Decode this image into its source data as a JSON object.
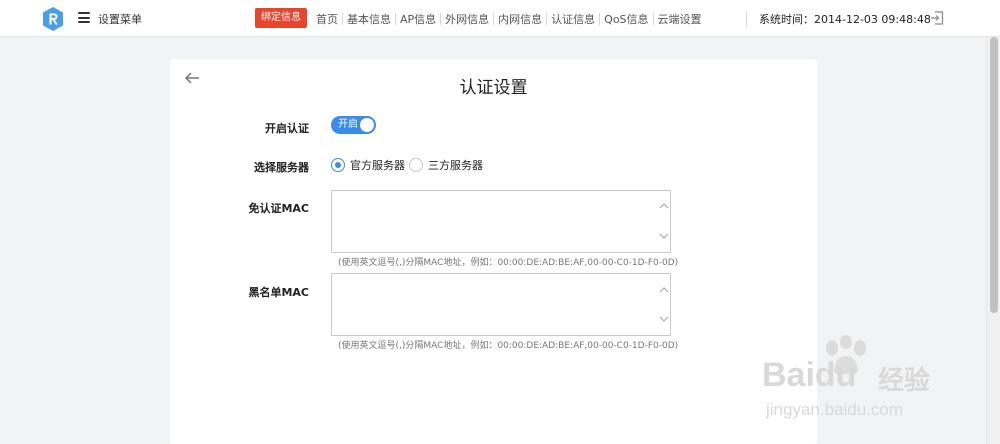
{
  "header": {
    "menu_label": "设置菜单",
    "bind_button": "绑定信息",
    "nav": [
      "首页",
      "基本信息",
      "AP信息",
      "外网信息",
      "内网信息",
      "认证信息",
      "QoS信息",
      "云端设置"
    ],
    "system_time": "系统时间：2014-12-03 09:48:48"
  },
  "page": {
    "title": "认证设置"
  },
  "form": {
    "auth_label": "开启认证",
    "toggle_text": "开启",
    "toggle_on": true,
    "server_label": "选择服务器",
    "server_options": [
      "官方服务器",
      "三方服务器"
    ],
    "server_selected": "官方服务器",
    "free_mac_label": "免认证MAC",
    "free_mac_value": "",
    "free_mac_hint": "(使用英文逗号(,)分隔MAC地址，例如：00:00:DE:AD:BE:AF,00-00-C0-1D-F0-0D)",
    "blacklist_label": "黑名单MAC",
    "blacklist_value": "",
    "blacklist_hint": "(使用英文逗号(,)分隔MAC地址，例如：00:00:DE:AD:BE:AF,00-00-C0-1D-F0-0D)"
  },
  "watermark": {
    "brand": "Baidu",
    "brand_cn": "经验",
    "url": "jingyan.baidu.com"
  },
  "colors": {
    "accent": "#3b8bea",
    "bind_button": "#e8452c",
    "logo": "#4a9de8"
  }
}
